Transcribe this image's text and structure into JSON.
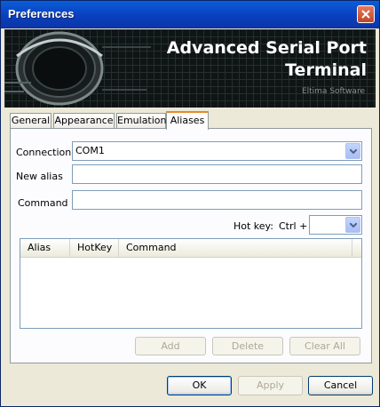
{
  "window": {
    "title": "Preferences"
  },
  "banner": {
    "title_line1": "Advanced Serial Port",
    "title_line2": "Terminal",
    "subtitle": "Eltima Software"
  },
  "tabs": [
    {
      "label": "General"
    },
    {
      "label": "Appearance"
    },
    {
      "label": "Emulation"
    },
    {
      "label": "Aliases"
    }
  ],
  "active_tab": "Aliases",
  "form": {
    "connection_label": "Connection",
    "connection_value": "COM1",
    "new_alias_label": "New alias",
    "new_alias_value": "",
    "command_label": "Command",
    "command_value": "",
    "hotkey_label": "Hot key:",
    "hotkey_prefix": "Ctrl +",
    "hotkey_value": ""
  },
  "list": {
    "columns": [
      "Alias",
      "HotKey",
      "Command"
    ],
    "rows": []
  },
  "list_buttons": {
    "add": "Add",
    "delete": "Delete",
    "clear_all": "Clear All"
  },
  "dialog_buttons": {
    "ok": "OK",
    "apply": "Apply",
    "cancel": "Cancel"
  },
  "icons": {
    "close": "close-icon",
    "dropdown": "chevron-down-icon"
  },
  "colors": {
    "title_bar": "#0a3fbf",
    "active_tab_accent": "#e68b2c",
    "banner_bg": "#0f1414"
  }
}
